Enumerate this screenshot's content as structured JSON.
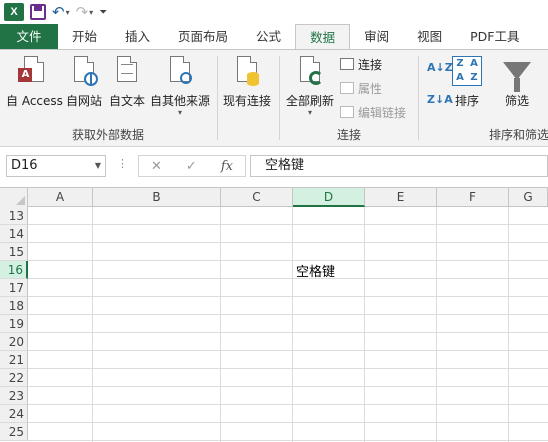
{
  "qat": {
    "logo": "X"
  },
  "tabs": [
    "文件",
    "开始",
    "插入",
    "页面布局",
    "公式",
    "数据",
    "审阅",
    "视图",
    "PDF工具"
  ],
  "active_tab": "数据",
  "ribbon": {
    "external": {
      "label": "获取外部数据",
      "buttons": [
        "自 Access",
        "自网站",
        "自文本",
        "自其他来源"
      ]
    },
    "existing_connections": "现有连接",
    "connections": {
      "label": "连接",
      "refresh_all": "全部刷新",
      "connections": "连接",
      "properties": "属性",
      "edit_links": "编辑链接"
    },
    "sort_filter": {
      "label": "排序和筛选",
      "sort": "排序",
      "filter": "筛选",
      "az": "A↓Z",
      "za": "Z↓A",
      "grid": [
        "Z",
        "A",
        "A",
        "Z"
      ]
    }
  },
  "formula_bar": {
    "name_box": "D16",
    "cancel": "✕",
    "confirm": "✓",
    "fx": "fx",
    "value": "空格键"
  },
  "columns": [
    "A",
    "B",
    "C",
    "D",
    "E",
    "F",
    "G"
  ],
  "selected_column": "D",
  "rows": [
    "13",
    "14",
    "15",
    "16",
    "17",
    "18",
    "19",
    "20",
    "21",
    "22",
    "23",
    "24",
    "25"
  ],
  "selected_row": "16",
  "cells": {
    "D16": "空格键"
  }
}
